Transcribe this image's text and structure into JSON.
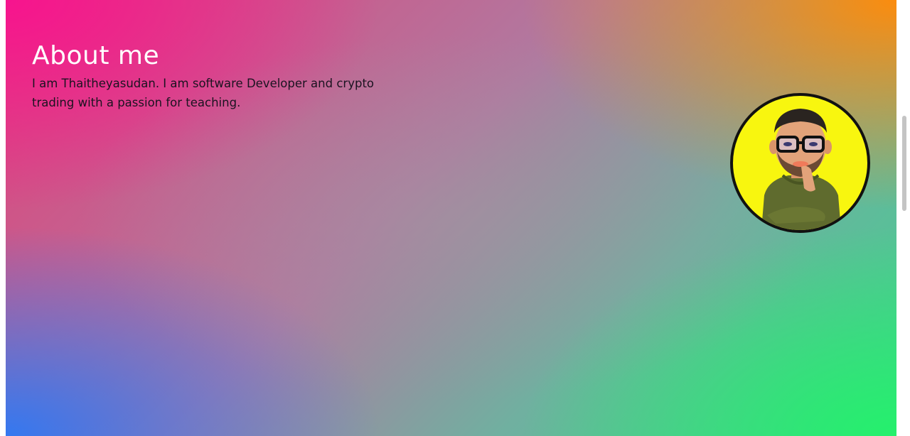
{
  "about": {
    "title": "About me",
    "description": "I am Thaitheyasudan. I am software Developer and crypto trading with a passion for teaching."
  },
  "avatar": {
    "icon": "bitmoji-avatar-icon",
    "background_color": "#f8f60f"
  },
  "colors": {
    "gradient_top_left": "#f7148e",
    "gradient_top_right": "#fb8c0e",
    "gradient_bottom_left": "#3478f0",
    "gradient_bottom_right": "#25f06c"
  }
}
